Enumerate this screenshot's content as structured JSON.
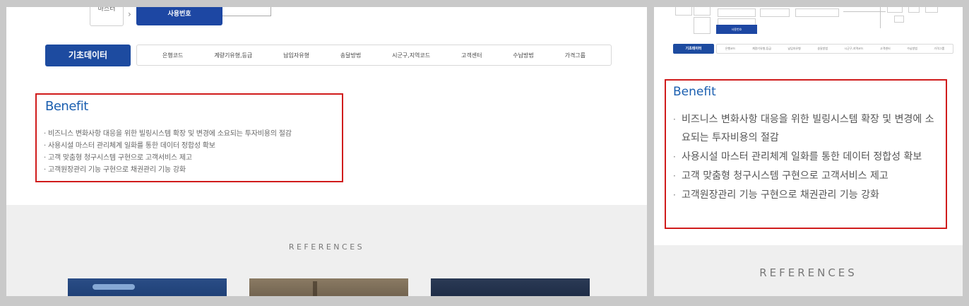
{
  "left": {
    "flow": {
      "small_box_line1": "",
      "small_box_line2": "마스터",
      "blue_box": "사용번호"
    },
    "master": {
      "button": "기초데이터",
      "tabs": [
        "은행코드",
        "계량기유형,등급",
        "납입자유형",
        "송달방법",
        "시군구,지역코드",
        "고객센터",
        "수납방법",
        "가격그룹"
      ]
    },
    "benefit": {
      "title": "Benefit",
      "items": [
        "· 비즈니스 변화사항 대응을 위한 빌링시스템 확장 및 변경에 소요되는 투자비용의 절감",
        "· 사용시설 마스터 관리체계 일화를 통한 데이터 정합성 확보",
        "· 고객 맞춤형 청구시스템 구현으로 고객서비스 제고",
        "· 고객원장관리 기능 구현으로 채권관리 기능 강화"
      ]
    },
    "references": {
      "title": "REFERENCES"
    }
  },
  "right": {
    "mini": {
      "master_button": "기초데이터",
      "blue_box": "사용번호",
      "tabs": [
        "은행코드",
        "계량기유형,등급",
        "납입자유형",
        "송달방법",
        "시군구,지역코드",
        "고객센터",
        "수납방법",
        "가격그룹"
      ]
    },
    "benefit": {
      "title": "Benefit",
      "items": [
        "비즈니스 변화사항 대응을 위한 빌링시스템 확장 및 변경에 소요되는 투자비용의 절감",
        "사용시설 마스터 관리체계 일화를 통한 데이터 정합성 확보",
        "고객 맞춤형 청구시스템 구현으로 고객서비스 제고",
        "고객원장관리 기능 구현으로 채권관리 기능 강화"
      ]
    },
    "references": {
      "title": "REFERENCES"
    }
  },
  "colors": {
    "accent_blue": "#1d47a3",
    "title_blue": "#1b5fb0",
    "highlight_red": "#d01c1c"
  }
}
